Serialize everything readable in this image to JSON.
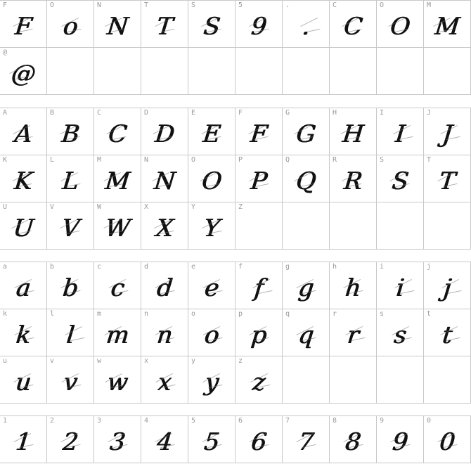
{
  "sections": [
    {
      "name": "sample-text",
      "rows": [
        [
          {
            "key": "F",
            "glyph": "F"
          },
          {
            "key": "O",
            "glyph": "o"
          },
          {
            "key": "N",
            "glyph": "N"
          },
          {
            "key": "T",
            "glyph": "T"
          },
          {
            "key": "S",
            "glyph": "S"
          },
          {
            "key": "5",
            "glyph": "9"
          },
          {
            "key": ".",
            "glyph": "."
          },
          {
            "key": "C",
            "glyph": "C"
          },
          {
            "key": "O",
            "glyph": "O"
          },
          {
            "key": "M",
            "glyph": "M"
          }
        ],
        [
          {
            "key": "@",
            "glyph": "@"
          },
          {
            "key": "",
            "glyph": ""
          },
          {
            "key": "",
            "glyph": ""
          },
          {
            "key": "",
            "glyph": ""
          },
          {
            "key": "",
            "glyph": ""
          },
          {
            "key": "",
            "glyph": ""
          },
          {
            "key": "",
            "glyph": ""
          },
          {
            "key": "",
            "glyph": ""
          },
          {
            "key": "",
            "glyph": ""
          },
          {
            "key": "",
            "glyph": ""
          }
        ]
      ]
    },
    {
      "name": "uppercase",
      "rows": [
        [
          {
            "key": "A",
            "glyph": "A"
          },
          {
            "key": "B",
            "glyph": "B"
          },
          {
            "key": "C",
            "glyph": "C"
          },
          {
            "key": "D",
            "glyph": "D"
          },
          {
            "key": "E",
            "glyph": "E"
          },
          {
            "key": "F",
            "glyph": "F"
          },
          {
            "key": "G",
            "glyph": "G"
          },
          {
            "key": "H",
            "glyph": "H"
          },
          {
            "key": "I",
            "glyph": "I"
          },
          {
            "key": "J",
            "glyph": "J"
          }
        ],
        [
          {
            "key": "K",
            "glyph": "K"
          },
          {
            "key": "L",
            "glyph": "L"
          },
          {
            "key": "M",
            "glyph": "M"
          },
          {
            "key": "N",
            "glyph": "N"
          },
          {
            "key": "O",
            "glyph": "O"
          },
          {
            "key": "P",
            "glyph": "P"
          },
          {
            "key": "Q",
            "glyph": "Q"
          },
          {
            "key": "R",
            "glyph": "R"
          },
          {
            "key": "S",
            "glyph": "S"
          },
          {
            "key": "T",
            "glyph": "T"
          }
        ],
        [
          {
            "key": "U",
            "glyph": "U"
          },
          {
            "key": "V",
            "glyph": "V"
          },
          {
            "key": "W",
            "glyph": "W"
          },
          {
            "key": "X",
            "glyph": "X"
          },
          {
            "key": "Y",
            "glyph": "Y"
          },
          {
            "key": "Z",
            "glyph": ""
          },
          {
            "key": "",
            "glyph": ""
          },
          {
            "key": "",
            "glyph": ""
          },
          {
            "key": "",
            "glyph": ""
          },
          {
            "key": "",
            "glyph": ""
          }
        ]
      ]
    },
    {
      "name": "lowercase",
      "rows": [
        [
          {
            "key": "a",
            "glyph": "a"
          },
          {
            "key": "b",
            "glyph": "b"
          },
          {
            "key": "c",
            "glyph": "c"
          },
          {
            "key": "d",
            "glyph": "d"
          },
          {
            "key": "e",
            "glyph": "e"
          },
          {
            "key": "f",
            "glyph": "f"
          },
          {
            "key": "g",
            "glyph": "g"
          },
          {
            "key": "h",
            "glyph": "h"
          },
          {
            "key": "i",
            "glyph": "i"
          },
          {
            "key": "j",
            "glyph": "j"
          }
        ],
        [
          {
            "key": "k",
            "glyph": "k"
          },
          {
            "key": "l",
            "glyph": "l"
          },
          {
            "key": "m",
            "glyph": "m"
          },
          {
            "key": "n",
            "glyph": "n"
          },
          {
            "key": "o",
            "glyph": "o"
          },
          {
            "key": "p",
            "glyph": "p"
          },
          {
            "key": "q",
            "glyph": "q"
          },
          {
            "key": "r",
            "glyph": "r"
          },
          {
            "key": "s",
            "glyph": "s"
          },
          {
            "key": "t",
            "glyph": "t"
          }
        ],
        [
          {
            "key": "u",
            "glyph": "u"
          },
          {
            "key": "v",
            "glyph": "v"
          },
          {
            "key": "w",
            "glyph": "w"
          },
          {
            "key": "x",
            "glyph": "x"
          },
          {
            "key": "y",
            "glyph": "y"
          },
          {
            "key": "z",
            "glyph": "z"
          },
          {
            "key": "",
            "glyph": ""
          },
          {
            "key": "",
            "glyph": ""
          },
          {
            "key": "",
            "glyph": ""
          },
          {
            "key": "",
            "glyph": ""
          }
        ]
      ]
    },
    {
      "name": "digits",
      "rows": [
        [
          {
            "key": "1",
            "glyph": "1"
          },
          {
            "key": "2",
            "glyph": "2"
          },
          {
            "key": "3",
            "glyph": "3"
          },
          {
            "key": "4",
            "glyph": "4"
          },
          {
            "key": "5",
            "glyph": "5"
          },
          {
            "key": "6",
            "glyph": "6"
          },
          {
            "key": "7",
            "glyph": "7"
          },
          {
            "key": "8",
            "glyph": "8"
          },
          {
            "key": "9",
            "glyph": "9"
          },
          {
            "key": "0",
            "glyph": "0"
          }
        ]
      ]
    }
  ]
}
